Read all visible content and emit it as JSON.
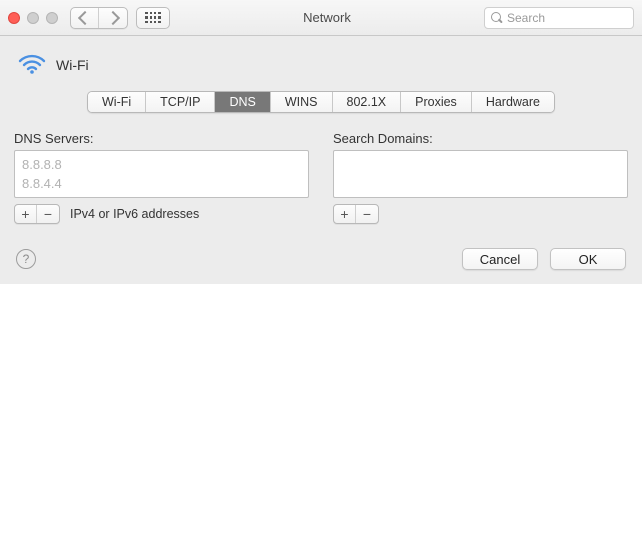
{
  "window": {
    "title": "Network"
  },
  "search": {
    "placeholder": "Search"
  },
  "interface": {
    "label": "Wi-Fi"
  },
  "tabs": [
    {
      "label": "Wi-Fi",
      "active": false
    },
    {
      "label": "TCP/IP",
      "active": false
    },
    {
      "label": "DNS",
      "active": true
    },
    {
      "label": "WINS",
      "active": false
    },
    {
      "label": "802.1X",
      "active": false
    },
    {
      "label": "Proxies",
      "active": false
    },
    {
      "label": "Hardware",
      "active": false
    }
  ],
  "dns": {
    "label": "DNS Servers:",
    "servers": [
      "8.8.8.8",
      "8.8.4.4"
    ],
    "hint": "IPv4 or IPv6 addresses"
  },
  "search_domains": {
    "label": "Search Domains:",
    "items": []
  },
  "buttons": {
    "cancel": "Cancel",
    "ok": "OK",
    "plus": "+",
    "minus": "−",
    "help": "?"
  }
}
